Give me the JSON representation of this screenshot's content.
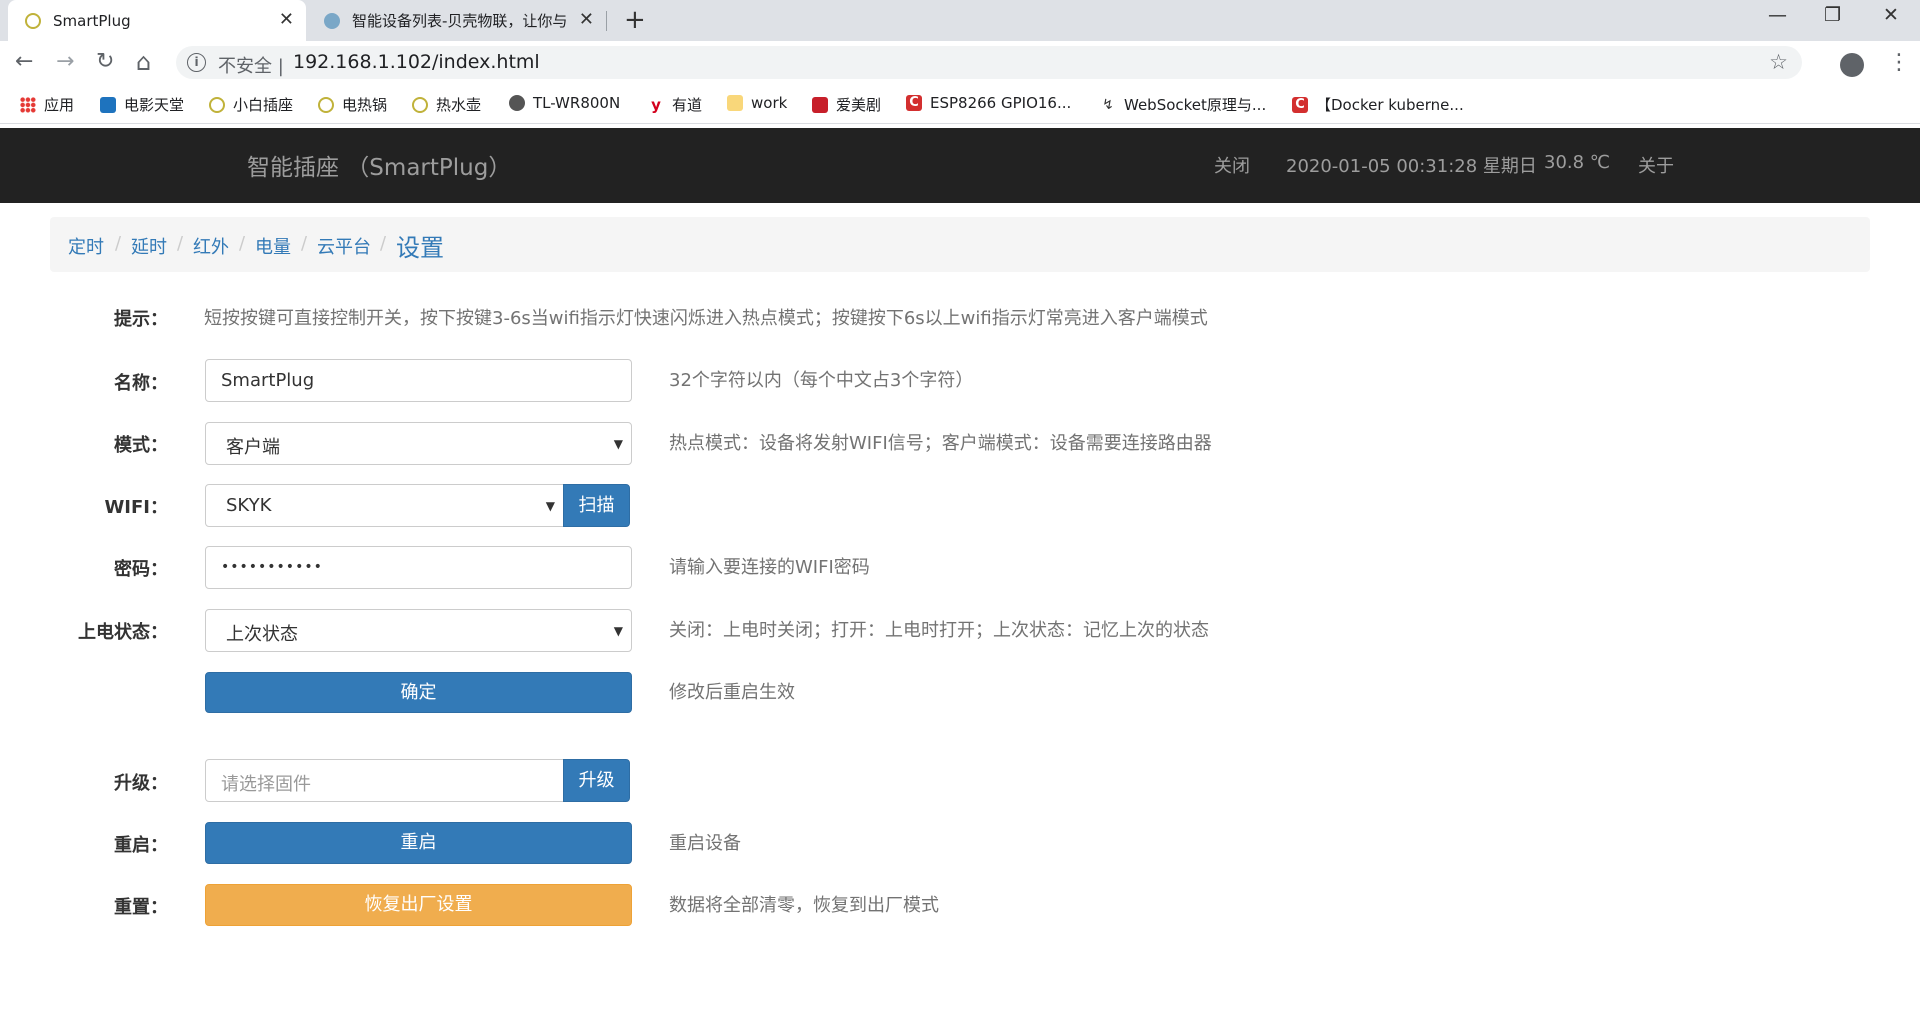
{
  "browser": {
    "tabs": [
      {
        "title": "SmartPlug",
        "close": "✕"
      },
      {
        "title": "智能设备列表-贝壳物联，让你与",
        "close": "✕"
      }
    ],
    "new_tab": "+",
    "window": {
      "minimize": "—",
      "restore": "❐",
      "close": "✕"
    },
    "nav": {
      "back": "←",
      "forward": "→",
      "reload": "↻",
      "home": "⌂"
    },
    "address": {
      "security_icon": "i",
      "security_label": "不安全 |",
      "url": "192.168.1.102/index.html",
      "star": "☆"
    },
    "menu": "⋮",
    "bookmarks": [
      {
        "label": "应用",
        "icon": "apps-icon"
      },
      {
        "label": "电影天堂",
        "icon": "film-icon"
      },
      {
        "label": "小白插座",
        "icon": "plug-icon"
      },
      {
        "label": "电热锅",
        "icon": "plug-icon"
      },
      {
        "label": "热水壶",
        "icon": "plug-icon"
      },
      {
        "label": "TL-WR800N",
        "icon": "globe-icon"
      },
      {
        "label": "有道",
        "icon": "youdao-icon"
      },
      {
        "label": "work",
        "icon": "folder-icon"
      },
      {
        "label": "爱美剧",
        "icon": "aimeiju-icon"
      },
      {
        "label": "ESP8266 GPIO16...",
        "icon": "csdn-icon"
      },
      {
        "label": "WebSocket原理与...",
        "icon": "websocket-icon"
      },
      {
        "label": "【Docker kuberne...",
        "icon": "csdn-icon"
      }
    ]
  },
  "navbar": {
    "brand": "智能插座 （SmartPlug）",
    "status": "关闭",
    "datetime": "2020-01-05 00:31:28 星期日",
    "temperature": "30.8 ℃",
    "about": "关于"
  },
  "breadcrumb": {
    "items": [
      "定时",
      "延时",
      "红外",
      "电量",
      "云平台"
    ],
    "separator": "/",
    "active": "设置"
  },
  "form": {
    "tip": {
      "label": "提示：",
      "text": "短按按键可直接控制开关，按下按键3-6s当wifi指示灯快速闪烁进入热点模式；按键按下6s以上wifi指示灯常亮进入客户端模式"
    },
    "name": {
      "label": "名称：",
      "value": "SmartPlug",
      "help": "32个字符以内（每个中文占3个字符）"
    },
    "mode": {
      "label": "模式：",
      "value": "客户端",
      "help": "热点模式：设备将发射WIFI信号；客户端模式：设备需要连接路由器"
    },
    "wifi": {
      "label": "WIFI：",
      "value": "SKYK",
      "scan_button": "扫描"
    },
    "password": {
      "label": "密码：",
      "value": "•••••••••••",
      "help": "请输入要连接的WIFI密码"
    },
    "power_state": {
      "label": "上电状态：",
      "value": "上次状态",
      "help": "关闭：上电时关闭；打开：上电时打开；上次状态：记忆上次的状态"
    },
    "confirm": {
      "button": "确定",
      "help": "修改后重启生效"
    },
    "upgrade": {
      "label": "升级：",
      "placeholder": "请选择固件",
      "button": "升级"
    },
    "reboot": {
      "label": "重启：",
      "button": "重启",
      "help": "重启设备"
    },
    "reset": {
      "label": "重置：",
      "button": "恢复出厂设置",
      "help": "数据将全部清零，恢复到出厂模式"
    }
  },
  "colors": {
    "primary": "#337ab7",
    "warning": "#f0ad4e",
    "navbar": "#222222"
  }
}
